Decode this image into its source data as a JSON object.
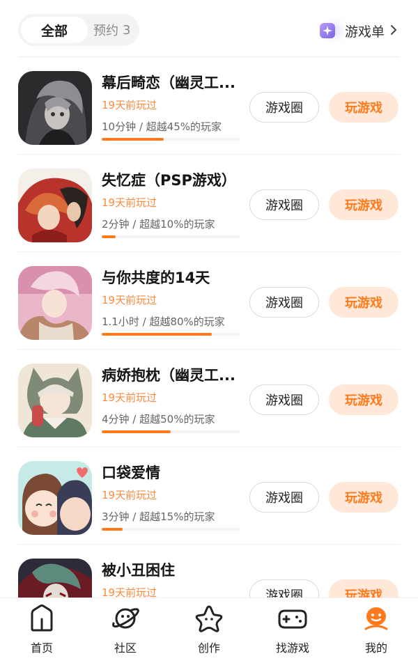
{
  "tabs": {
    "all": "全部",
    "reserved_label": "预约",
    "reserved_count": "3",
    "gamelist": "游戏单"
  },
  "games": [
    {
      "title": "幕后畸恋（幽灵工...",
      "played": "19天前玩过",
      "stats": "10分钟 / 超越45%的玩家",
      "progress": 0.45,
      "circle": "游戏圈",
      "play": "玩游戏"
    },
    {
      "title": "失忆症（PSP游戏）",
      "played": "19天前玩过",
      "stats": "2分钟 / 超越10%的玩家",
      "progress": 0.1,
      "circle": "游戏圈",
      "play": "玩游戏"
    },
    {
      "title": "与你共度的14天",
      "played": "19天前玩过",
      "stats": "1.1小时 / 超越80%的玩家",
      "progress": 0.8,
      "circle": "游戏圈",
      "play": "玩游戏"
    },
    {
      "title": "病娇抱枕（幽灵工...",
      "played": "19天前玩过",
      "stats": "4分钟 / 超越50%的玩家",
      "progress": 0.5,
      "circle": "游戏圈",
      "play": "玩游戏"
    },
    {
      "title": "口袋爱情",
      "played": "19天前玩过",
      "stats": "3分钟 / 超越15%的玩家",
      "progress": 0.15,
      "circle": "游戏圈",
      "play": "玩游戏"
    },
    {
      "title": "被小丑困住",
      "played": "19天前玩过",
      "stats": "",
      "progress": 0.0,
      "circle": "游戏圈",
      "play": "玩游戏"
    }
  ],
  "nav": {
    "home": "首页",
    "community": "社区",
    "create": "创作",
    "find_games": "找游戏",
    "mine": "我的"
  },
  "colors": {
    "accent": "#ff7a1a",
    "accent_soft": "#ffe8d7",
    "played_text": "#ff8a3d"
  }
}
